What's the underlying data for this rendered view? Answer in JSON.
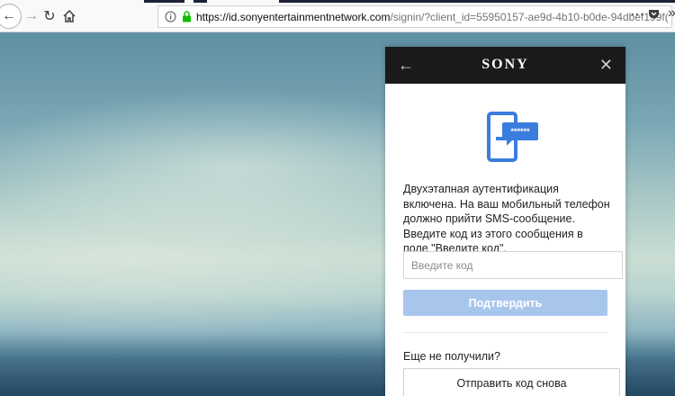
{
  "browser": {
    "url_host": "https://id.sonyentertainmentnetwork.com",
    "url_rest": "/signin/?client_id=55950157-ae9d-4b10-b0de-94dbef199f(",
    "icons": [
      "back-icon",
      "forward-icon",
      "reload-icon",
      "home-icon",
      "info-icon",
      "lock-icon",
      "more-icon",
      "pocket-icon",
      "overflow-icon"
    ]
  },
  "modal": {
    "brand": "SONY",
    "message": "Двухэтапная аутентификация включена. На ваш мобильный телефон должно прийти SMS-сообщение. Введите код из этого сообщения в поле \"Введите код\".",
    "code_placeholder": "Введите код",
    "confirm_label": "Подтвердить",
    "not_received_label": "Еще не получили?",
    "resend_label": "Отправить код снова",
    "sms_mask": "******"
  },
  "colors": {
    "header_bg": "#1a1a1a",
    "confirm_bg": "#a8c6ec",
    "phone_blue": "#3b7ddd"
  }
}
